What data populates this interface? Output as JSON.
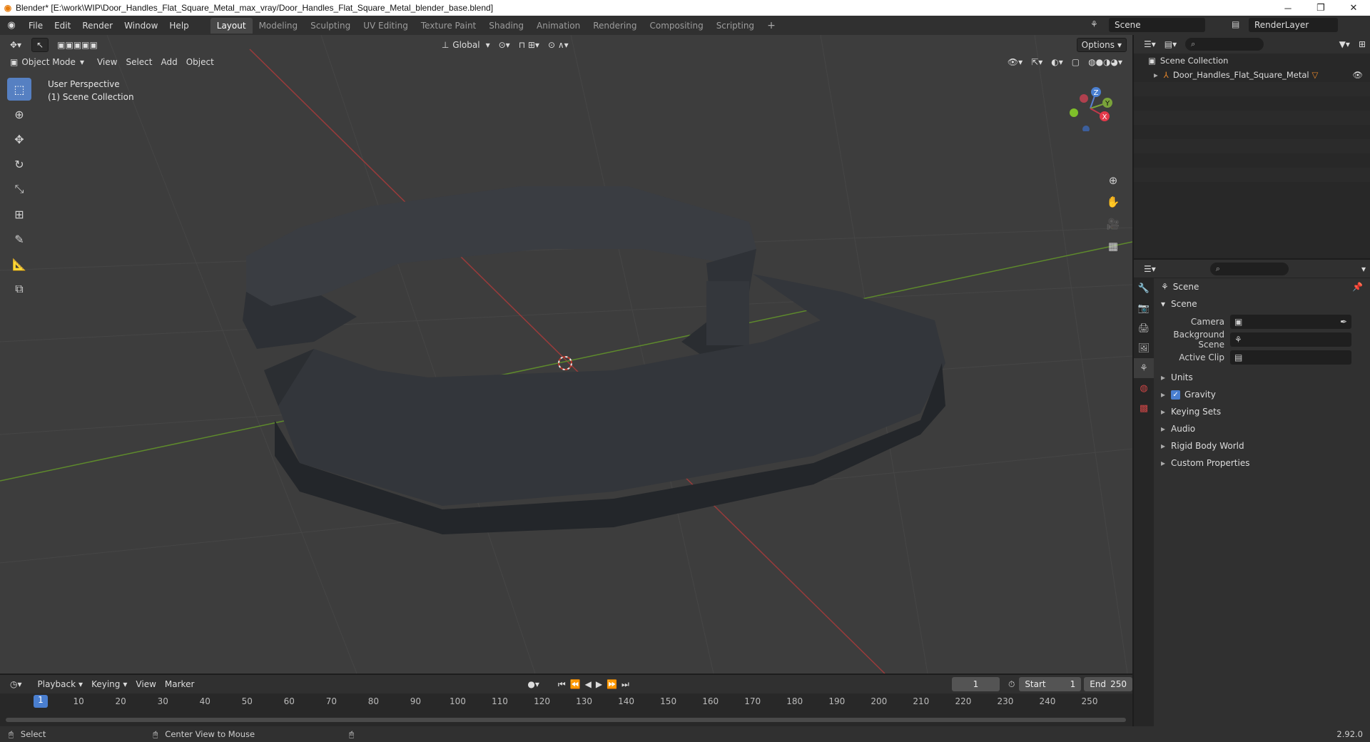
{
  "window": {
    "title": "Blender* [E:\\work\\WIP\\Door_Handles_Flat_Square_Metal_max_vray/Door_Handles_Flat_Square_Metal_blender_base.blend]",
    "minimize": "─",
    "restore": "❐",
    "close": "✕"
  },
  "menu": [
    "File",
    "Edit",
    "Render",
    "Window",
    "Help"
  ],
  "workspace_tabs": [
    {
      "label": "Layout",
      "active": true
    },
    {
      "label": "Modeling"
    },
    {
      "label": "Sculpting"
    },
    {
      "label": "UV Editing"
    },
    {
      "label": "Texture Paint"
    },
    {
      "label": "Shading"
    },
    {
      "label": "Animation"
    },
    {
      "label": "Rendering"
    },
    {
      "label": "Compositing"
    },
    {
      "label": "Scripting"
    }
  ],
  "scene_field": "Scene",
  "renderlayer_field": "RenderLayer",
  "viewport": {
    "orientation": "Global",
    "options": "Options",
    "mode": "Object Mode",
    "menus": [
      "View",
      "Select",
      "Add",
      "Object"
    ],
    "overlay_line1": "User Perspective",
    "overlay_line2": "(1) Scene Collection",
    "gizmo": {
      "x": "X",
      "y": "Y",
      "z": "Z"
    }
  },
  "outliner": {
    "collection": "Scene Collection",
    "object": "Door_Handles_Flat_Square_Metal"
  },
  "properties": {
    "header": "Scene",
    "section": "Scene",
    "rows": [
      {
        "label": "Camera",
        "value": ""
      },
      {
        "label": "Background Scene",
        "value": ""
      },
      {
        "label": "Active Clip",
        "value": ""
      }
    ],
    "panels": [
      "Units",
      "Gravity",
      "Keying Sets",
      "Audio",
      "Rigid Body World",
      "Custom Properties"
    ]
  },
  "timeline": {
    "menus": [
      "Playback",
      "Keying",
      "View",
      "Marker"
    ],
    "current_frame": "1",
    "start_label": "Start",
    "start": "1",
    "end_label": "End",
    "end": "250",
    "ticks": [
      "1",
      "10",
      "20",
      "30",
      "40",
      "50",
      "60",
      "70",
      "80",
      "90",
      "100",
      "110",
      "120",
      "130",
      "140",
      "150",
      "160",
      "170",
      "180",
      "190",
      "200",
      "210",
      "220",
      "230",
      "240",
      "250"
    ]
  },
  "status": {
    "select": "Select",
    "center": "Center View to Mouse",
    "version": "2.92.0"
  }
}
